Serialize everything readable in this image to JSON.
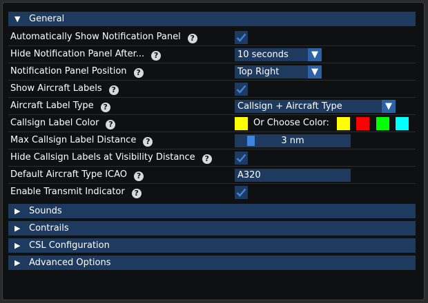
{
  "general": {
    "title": "General",
    "rows": {
      "auto_show": {
        "label": "Automatically Show Notification Panel",
        "checked": true
      },
      "hide_after": {
        "label": "Hide Notification Panel After...",
        "value": "10 seconds"
      },
      "position": {
        "label": "Notification Panel Position",
        "value": "Top Right"
      },
      "show_labels": {
        "label": "Show Aircraft Labels",
        "checked": true
      },
      "label_type": {
        "label": "Aircraft Label Type",
        "value": "Callsign + Aircraft Type"
      },
      "label_color": {
        "label": "Callsign Label Color",
        "selected_color": "#ffff00",
        "choose_text": "Or Choose Color:",
        "color_options": [
          "#ffff00",
          "#ff0000",
          "#00ff00",
          "#00ffff"
        ]
      },
      "max_distance": {
        "label": "Max Callsign Label Distance",
        "value": "3 nm",
        "slider_fraction": 0.1
      },
      "hide_at_visibility": {
        "label": "Hide Callsign Labels at Visibility Distance",
        "checked": true
      },
      "default_icao": {
        "label": "Default Aircraft Type ICAO",
        "value": "A320"
      },
      "transmit_indicator": {
        "label": "Enable Transmit Indicator",
        "checked": true
      }
    },
    "help_glyph": "?"
  },
  "collapsed_sections": {
    "sounds": "Sounds",
    "contrails": "Contrails",
    "csl": "CSL Configuration",
    "advanced": "Advanced Options"
  },
  "icons": {
    "expanded": "▼",
    "collapsed": "▶",
    "dropdown": "▼"
  },
  "colors": {
    "header_bg": "#1f3a5f",
    "control_bg": "#1f3a5f",
    "button_bg": "#2b63a6",
    "checkmark": "#3d86e0"
  }
}
